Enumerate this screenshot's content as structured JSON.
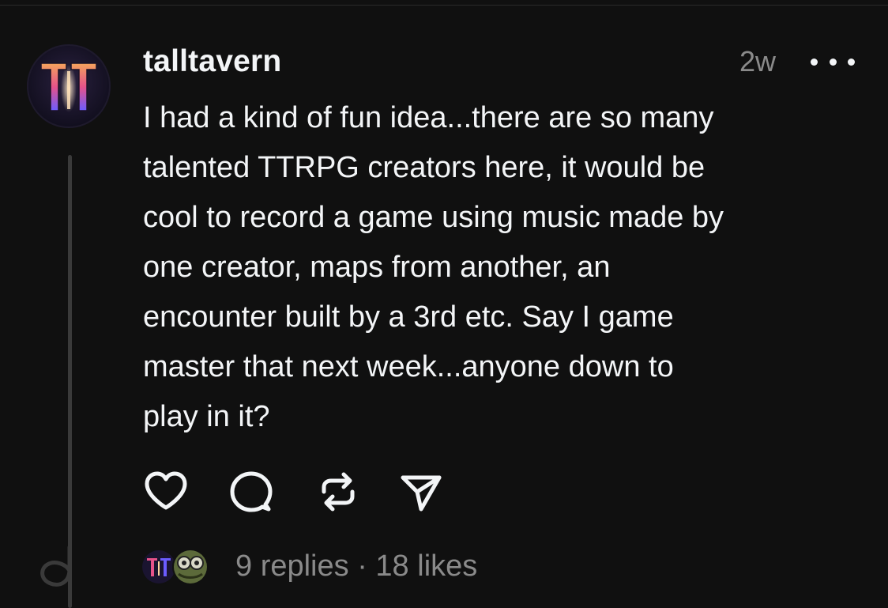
{
  "post": {
    "username": "talltavern",
    "timestamp": "2w",
    "body_lines": [
      "I had a kind of fun idea...there are so many",
      "talented TTRPG creators here, it would be",
      "cool to record a game using music made by",
      "one creator, maps from another, an",
      "encounter built by a 3rd etc. Say I game",
      "master that next week...anyone down to",
      "play in it?"
    ]
  },
  "avatar": {
    "logo_text": "TT",
    "colors": {
      "gradient_top": "#f5a45c",
      "gradient_mid": "#e6528a",
      "gradient_bottom": "#6b5cff",
      "glow": "#ffd7a0"
    }
  },
  "actions": {
    "like_icon": "heart-icon",
    "comment_icon": "comment-icon",
    "repost_icon": "repost-icon",
    "share_icon": "share-icon"
  },
  "footer": {
    "replies": "9 replies",
    "separator": "·",
    "likes": "18 likes"
  },
  "colors": {
    "background": "#101010",
    "text_primary": "#f3f5f7",
    "text_secondary": "#8a8a8a",
    "thread_line": "#3a3a3a"
  }
}
